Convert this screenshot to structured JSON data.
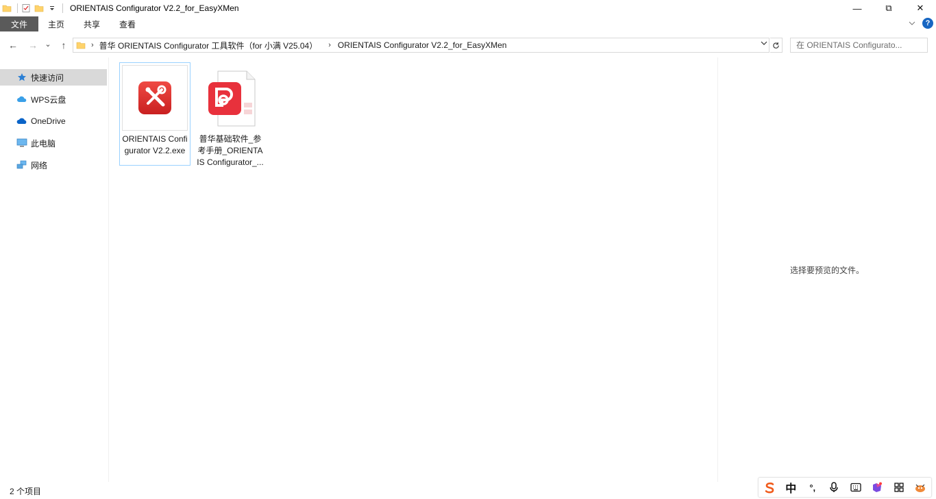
{
  "window": {
    "title": "ORIENTAIS Configurator V2.2_for_EasyXMen",
    "controls": {
      "minimize": "—",
      "maximize": "⧉",
      "close": "✕"
    }
  },
  "ribbon": {
    "tabs": [
      {
        "label": "文件"
      },
      {
        "label": "主页"
      },
      {
        "label": "共享"
      },
      {
        "label": "查看"
      }
    ]
  },
  "nav": {
    "back": "←",
    "forward": "→",
    "recent": "⌄",
    "up": "↑"
  },
  "address": {
    "crumbs": [
      "普华 ORIENTAIS Configurator 工具软件（for 小满 V25.04）",
      "ORIENTAIS Configurator V2.2_for_EasyXMen"
    ]
  },
  "search": {
    "placeholder": "在 ORIENTAIS Configurato..."
  },
  "sidebar": {
    "items": [
      {
        "label": "快速访问",
        "icon": "star-icon"
      },
      {
        "label": "WPS云盘",
        "icon": "cloud-icon"
      },
      {
        "label": "OneDrive",
        "icon": "onedrive-icon"
      },
      {
        "label": "此电脑",
        "icon": "computer-icon"
      },
      {
        "label": "网络",
        "icon": "network-icon"
      }
    ]
  },
  "files": [
    {
      "name": "ORIENTAIS Configurator V2.2.exe",
      "icon": "tools-app-icon"
    },
    {
      "name": "普华基础软件_参考手册_ORIENTAIS Configurator_...",
      "icon": "wps-pdf-icon"
    }
  ],
  "preview": {
    "message": "选择要预览的文件。"
  },
  "status": {
    "count": "2 个项目"
  },
  "ime": {
    "mode": "中",
    "punct": "°,"
  },
  "colors": {
    "accent": "#1f65b4",
    "app_red": "#e03a3a",
    "folder_yellow": "#ffd36b"
  }
}
